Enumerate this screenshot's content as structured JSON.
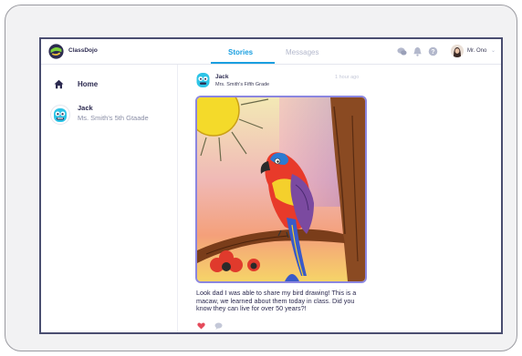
{
  "app": {
    "brand": "ClassDojo",
    "accent": "#1a9fe0",
    "like_color": "#e54b5b"
  },
  "header": {
    "tabs": [
      {
        "label": "Stories",
        "active": true
      },
      {
        "label": "Messages",
        "active": false
      }
    ],
    "icons": [
      "chat-bubbles-icon",
      "bell-icon",
      "help-icon"
    ],
    "user_name": "Mr. Ono"
  },
  "sidebar": {
    "home_label": "Home",
    "student": {
      "name": "Jack",
      "class_name": "Ms. Smith's 5th Gtaade"
    }
  },
  "post": {
    "author": "Jack",
    "class_name": "Mrs. Smith's Fifth Grade",
    "time": "1 hour ago",
    "caption": "Look dad I was able to share my bird drawing! This is a macaw, we learned about them today in class. Did you know they can live for over 50 years?!",
    "liked": true
  }
}
